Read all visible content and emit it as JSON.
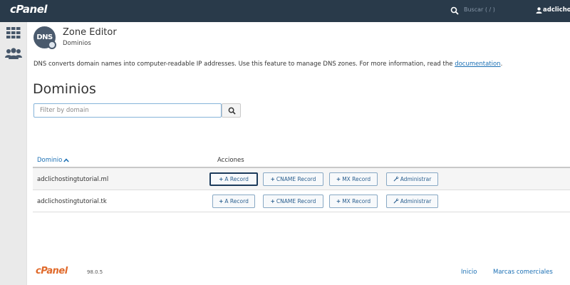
{
  "topbar": {
    "logo": "cPanel",
    "search_placeholder": "Buscar ( / )",
    "username": "adclichos"
  },
  "sidebar": {
    "items": [
      "grid-icon",
      "users-icon"
    ]
  },
  "header": {
    "badge": "DNS",
    "title": "Zone Editor",
    "subtitle": "Dominios"
  },
  "description": {
    "text": "DNS converts domain names into computer-readable IP addresses. Use this feature to manage DNS zones. For more information, read the ",
    "link": "documentation",
    "end": "."
  },
  "section": {
    "title": "Dominios"
  },
  "filter": {
    "placeholder": "Filter by domain"
  },
  "table": {
    "col_domain": "Dominio",
    "col_actions": "Acciones",
    "rows": [
      {
        "domain": "adclichostingtutorial.ml"
      },
      {
        "domain": "adclichostingtutorial.tk"
      }
    ],
    "actions": {
      "a_record": "A Record",
      "cname_record": "CNAME Record",
      "mx_record": "MX Record",
      "administrar": "Administrar"
    }
  },
  "footer": {
    "logo": "cPanel",
    "version": "98.0.5",
    "links": [
      "Inicio",
      "Marcas comerciales"
    ]
  },
  "colors": {
    "topbar": "#293a4a",
    "link": "#1a6fb4",
    "footer_logo": "#e06a2b"
  }
}
